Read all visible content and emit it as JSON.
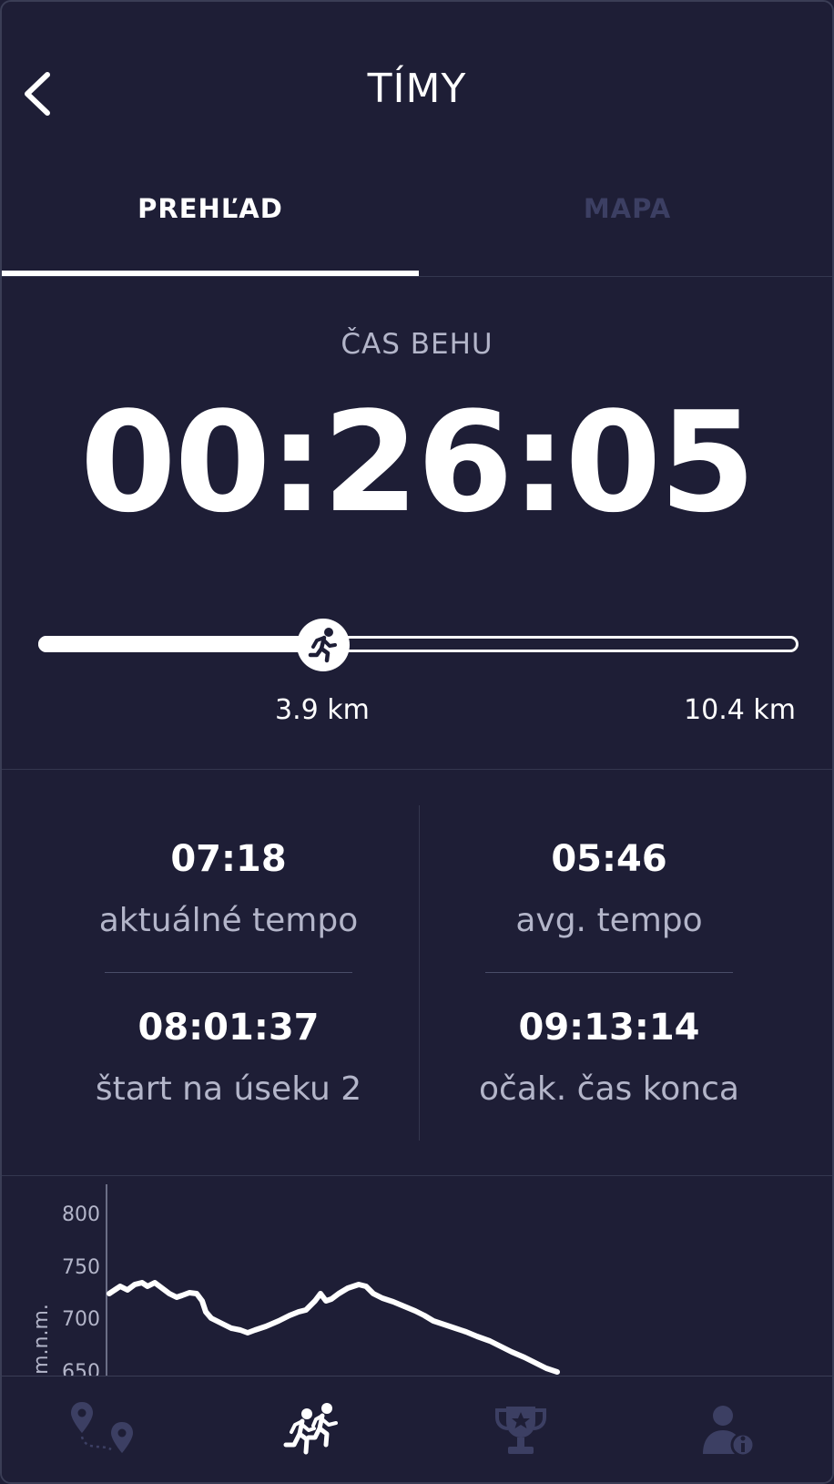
{
  "header": {
    "title": "TÍMY"
  },
  "tabs": [
    {
      "label": "PREHĽAD",
      "active": true
    },
    {
      "label": "MAPA",
      "active": false
    }
  ],
  "run": {
    "caption": "ČAS BEHU",
    "time": "00:26:05"
  },
  "progress": {
    "current_label": "3.9 km",
    "total_label": "10.4 km",
    "current_km": 3.9,
    "total_km": 10.4
  },
  "stats": [
    {
      "value": "07:18",
      "label": "aktuálné tempo"
    },
    {
      "value": "05:46",
      "label": "avg. tempo"
    },
    {
      "value": "08:01:37",
      "label": "štart na úseku 2"
    },
    {
      "value": "09:13:14",
      "label": "očak. čas konca"
    }
  ],
  "elevation": {
    "ylabel": "m.n.m.",
    "ticks": [
      "800",
      "750",
      "700",
      "650"
    ]
  },
  "nav": [
    {
      "icon": "route-pins-icon",
      "active": false
    },
    {
      "icon": "team-runners-icon",
      "active": true
    },
    {
      "icon": "trophy-icon",
      "active": false
    },
    {
      "icon": "user-info-icon",
      "active": false
    }
  ],
  "colors": {
    "background": "#1e1e36",
    "inactive": "#3c3f63",
    "muted_text": "#b3b5c9",
    "accent": "#ffffff"
  }
}
